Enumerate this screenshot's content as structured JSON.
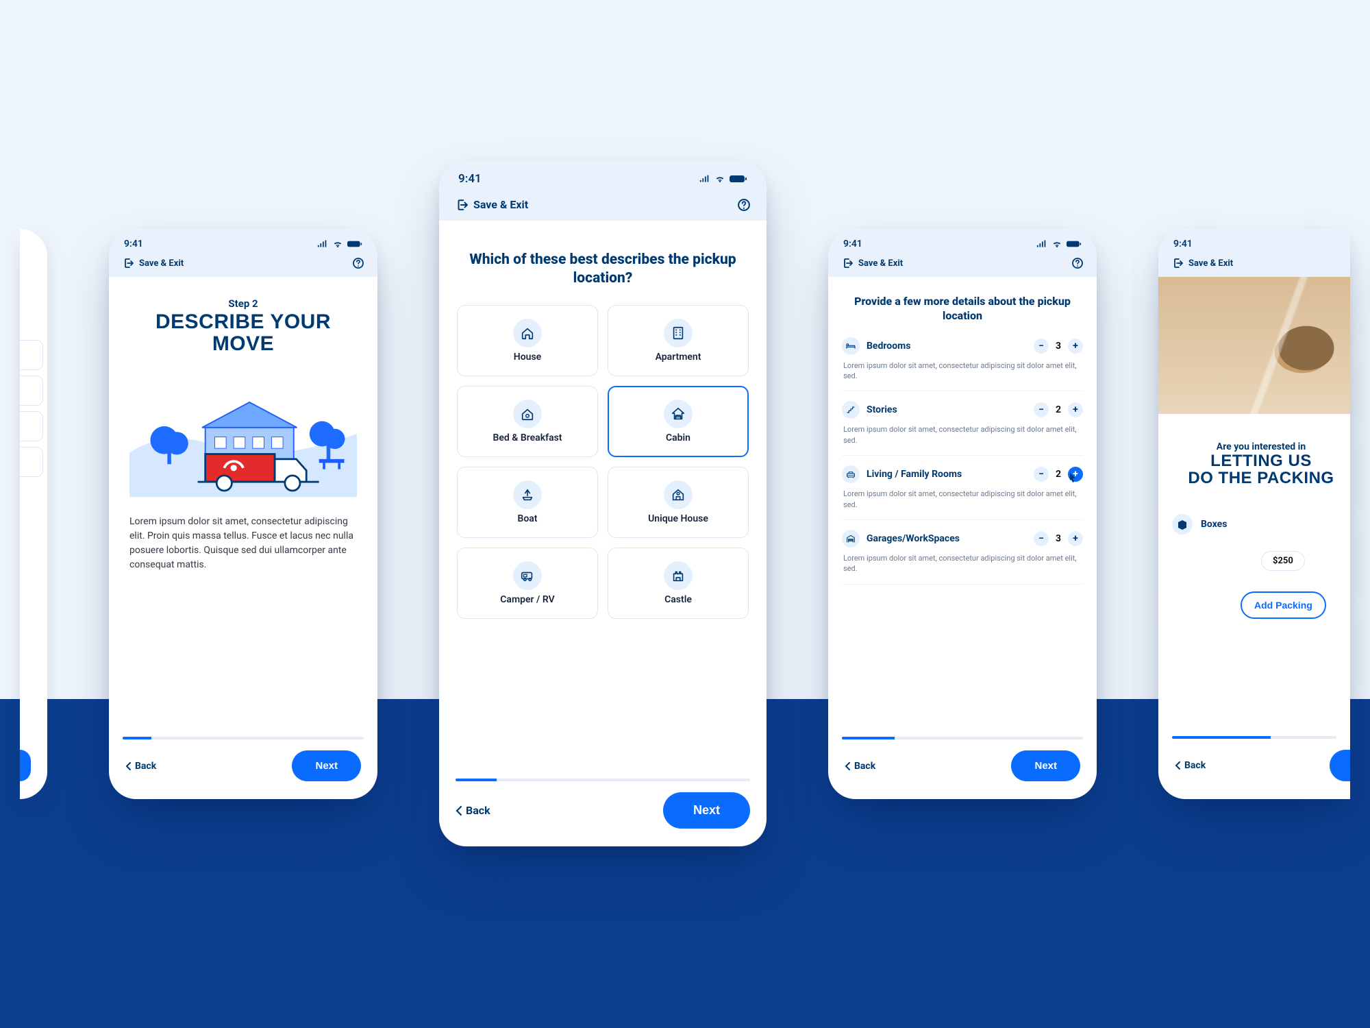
{
  "status": {
    "time": "9:41"
  },
  "header": {
    "save_exit": "Save & Exit"
  },
  "nav": {
    "back": "Back",
    "next": "Next"
  },
  "step2": {
    "step_label": "Step 2",
    "title": "DESCRIBE YOUR MOVE",
    "body": "Lorem ipsum dolor sit amet, consectetur adipiscing elit. Proin quis massa tellus. Fusce et lacus nec nulla posuere lobortis. Quisque sed dui ullamcorper ante consequat mattis."
  },
  "location": {
    "question": "Which of these best describes the pickup location?",
    "options": [
      {
        "label": "House",
        "icon": "house",
        "selected": false
      },
      {
        "label": "Apartment",
        "icon": "apartment",
        "selected": false
      },
      {
        "label": "Bed & Breakfast",
        "icon": "bnb",
        "selected": false
      },
      {
        "label": "Cabin",
        "icon": "cabin",
        "selected": true
      },
      {
        "label": "Boat",
        "icon": "boat",
        "selected": false
      },
      {
        "label": "Unique House",
        "icon": "unique-house",
        "selected": false
      },
      {
        "label": "Camper / RV",
        "icon": "camper",
        "selected": false
      },
      {
        "label": "Castle",
        "icon": "castle",
        "selected": false
      }
    ]
  },
  "details": {
    "question": "Provide a few more details about the pickup location",
    "desc": "Lorem ipsum dolor sit amet, consectetur adipiscing sit dolor amet elit, sed.",
    "rows": [
      {
        "name": "Bedrooms",
        "icon": "bed",
        "count": 3,
        "plus_active": false
      },
      {
        "name": "Stories",
        "icon": "stairs",
        "count": 2,
        "plus_active": false
      },
      {
        "name": "Living / Family Rooms",
        "icon": "living",
        "count": 2,
        "plus_active": true
      },
      {
        "name": "Garages/WorkSpaces",
        "icon": "garage",
        "count": 3,
        "plus_active": false
      }
    ]
  },
  "packing": {
    "heading_sm": "Are you interested in",
    "heading_lg_1": "LETTING US",
    "heading_lg_2": "DO THE PACKING",
    "item": {
      "name": "Boxes",
      "icon": "box"
    },
    "price": "$250",
    "add_btn": "Add Packing"
  }
}
